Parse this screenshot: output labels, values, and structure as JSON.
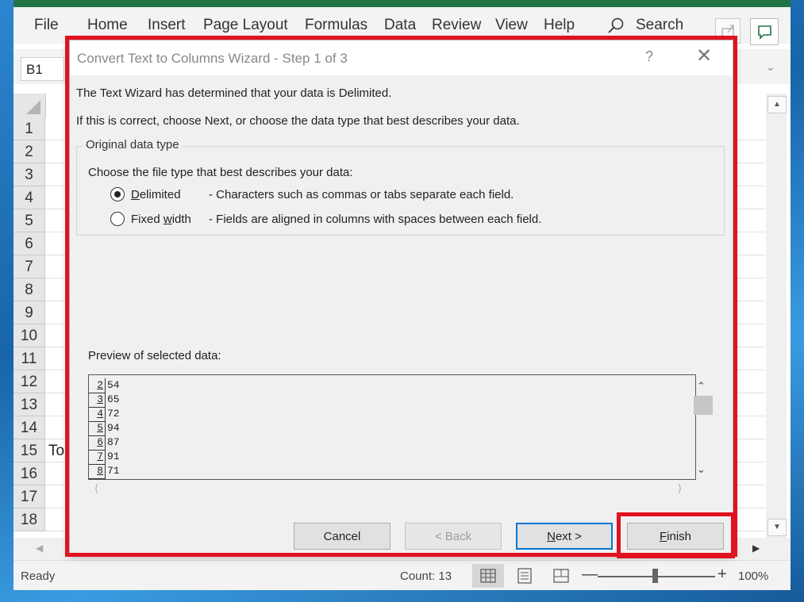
{
  "menu": {
    "items": [
      "File",
      "Home",
      "Insert",
      "Page Layout",
      "Formulas",
      "Data",
      "Review",
      "View",
      "Help"
    ],
    "search_label": "Search"
  },
  "name_box": "B1",
  "rows": [
    "1",
    "2",
    "3",
    "4",
    "5",
    "6",
    "7",
    "8",
    "9",
    "10",
    "11",
    "12",
    "13",
    "14",
    "15",
    "16",
    "17",
    "18"
  ],
  "cell_partial_text": "To",
  "status": {
    "ready": "Ready",
    "count": "Count: 13",
    "zoom": "100%"
  },
  "dialog": {
    "title": "Convert Text to Columns Wizard - Step 1 of 3",
    "help": "?",
    "close": "✕",
    "intro_line1": "The Text Wizard has determined that your data is Delimited.",
    "intro_line2": "If this is correct, choose Next, or choose the data type that best describes your data.",
    "group_legend": "Original data type",
    "group_prompt": "Choose the file type that best describes your data:",
    "options": [
      {
        "label": "Delimited",
        "desc": "- Characters such as commas or tabs separate each field.",
        "checked": true
      },
      {
        "label": "Fixed width",
        "desc": "- Fields are aligned in columns with spaces between each field.",
        "checked": false
      }
    ],
    "preview_label": "Preview of selected data:",
    "preview_rows": [
      {
        "num": "2",
        "val": "54"
      },
      {
        "num": "3",
        "val": "65"
      },
      {
        "num": "4",
        "val": "72"
      },
      {
        "num": "5",
        "val": "94"
      },
      {
        "num": "6",
        "val": "87"
      },
      {
        "num": "7",
        "val": "91"
      },
      {
        "num": "8",
        "val": "71"
      }
    ],
    "buttons": {
      "cancel": "Cancel",
      "back": "< Back",
      "next": "Next >",
      "finish": "Finish"
    }
  },
  "colors": {
    "excel_green": "#217346",
    "highlight_red": "#e0121f",
    "focus_blue": "#0078d7"
  }
}
